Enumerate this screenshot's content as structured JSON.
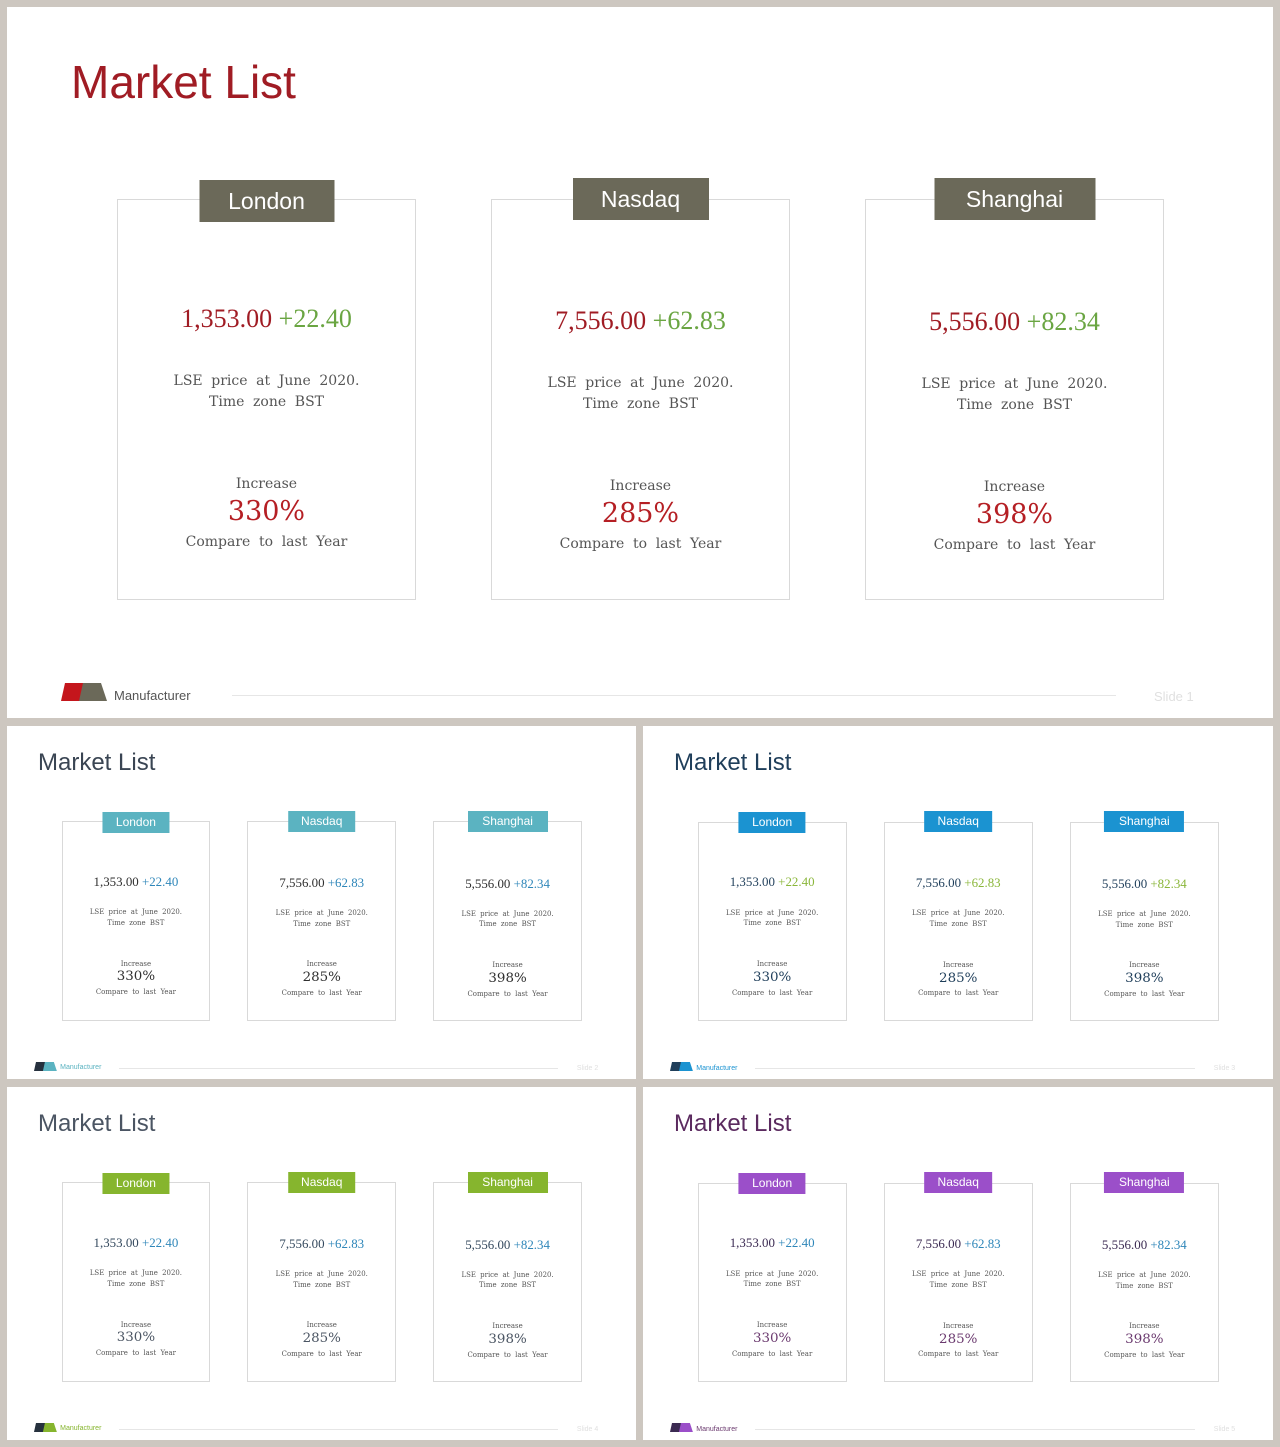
{
  "slides": [
    {
      "title": "Market List",
      "title_color": "#a01c24",
      "tab_color": "#6b6959",
      "price_color": "#a01c24",
      "change_color": "#6aa542",
      "percent_color": "#b51f24",
      "logo_colors": [
        "#c4161c",
        "#6b6959"
      ],
      "footer_text_color": "#555555",
      "footer": "Manufacturer",
      "slide_number": "Slide  1"
    },
    {
      "title": "Market List",
      "title_color": "#3a4553",
      "tab_color": "#5bb3c1",
      "price_color": "#2f2f2f",
      "change_color": "#2e86b9",
      "percent_color": "#2f2f2f",
      "logo_colors": [
        "#26313e",
        "#5bb3c1"
      ],
      "footer_text_color": "#5bb3c1",
      "footer": "Manufacturer",
      "slide_number": "Slide  2"
    },
    {
      "title": "Market List",
      "title_color": "#1f3e5a",
      "tab_color": "#1b93d1",
      "price_color": "#1f3e5a",
      "change_color": "#8ab63a",
      "percent_color": "#1f3e5a",
      "logo_colors": [
        "#1f3e5a",
        "#1b93d1"
      ],
      "footer_text_color": "#1b93d1",
      "footer": "Manufacturer",
      "slide_number": "Slide  3"
    },
    {
      "title": "Market List",
      "title_color": "#4b5563",
      "tab_color": "#86b52e",
      "price_color": "#34495e",
      "change_color": "#2e86b9",
      "percent_color": "#4b5563",
      "logo_colors": [
        "#26313e",
        "#86b52e"
      ],
      "footer_text_color": "#86b52e",
      "footer": "Manufacturer",
      "slide_number": "Slide  4"
    },
    {
      "title": "Market List",
      "title_color": "#5b2a5f",
      "tab_color": "#9b4fc9",
      "price_color": "#3b2a52",
      "change_color": "#2e86b9",
      "percent_color": "#6b3a6f",
      "logo_colors": [
        "#3b2a52",
        "#9b4fc9"
      ],
      "footer_text_color": "#6b3a6f",
      "footer": "Manufacturer",
      "slide_number": "Slide  5"
    }
  ],
  "markets": [
    {
      "name": "London",
      "price": "1,353.00",
      "change": "+22.40",
      "desc_line1": "LSE price at June 2020.",
      "desc_line2": "Time zone BST",
      "increase_label": "Increase",
      "percent": "330%",
      "compare": "Compare to last Year"
    },
    {
      "name": "Nasdaq",
      "price": "7,556.00",
      "change": "+62.83",
      "desc_line1": "LSE price at June 2020.",
      "desc_line2": "Time zone BST",
      "increase_label": "Increase",
      "percent": "285%",
      "compare": "Compare to last Year"
    },
    {
      "name": "Shanghai",
      "price": "5,556.00",
      "change": "+82.34",
      "desc_line1": "LSE price at June 2020.",
      "desc_line2": "Time zone BST",
      "increase_label": "Increase",
      "percent": "398%",
      "compare": "Compare to last Year"
    }
  ]
}
